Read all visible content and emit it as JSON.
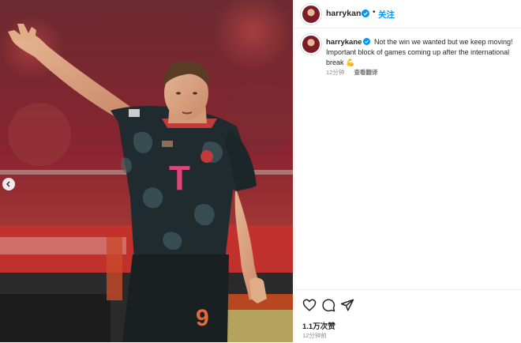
{
  "post": {
    "username": "harrykane",
    "follow_label": "关注",
    "separator": "•",
    "caption_line1": "Not the win we wanted but we keep moving!",
    "caption_line2": "Important block of games coming up after the international",
    "caption_line3": "break",
    "caption_emoji": "💪",
    "comment_time": "12分钟",
    "translate_label": "查看翻译",
    "likes": "1.1万次赞",
    "post_time": "12分钟前"
  },
  "photo": {
    "shirt_logo": "T",
    "shirt_number": "9"
  },
  "colors": {
    "follow": "#0095f6",
    "verified": "#0095f6",
    "jersey": "#1f2b2f",
    "background_crowd": "#8a2430"
  },
  "icons": {
    "like": "heart-icon",
    "comment": "comment-icon",
    "share": "send-icon",
    "carousel": "chevron-left-icon"
  }
}
